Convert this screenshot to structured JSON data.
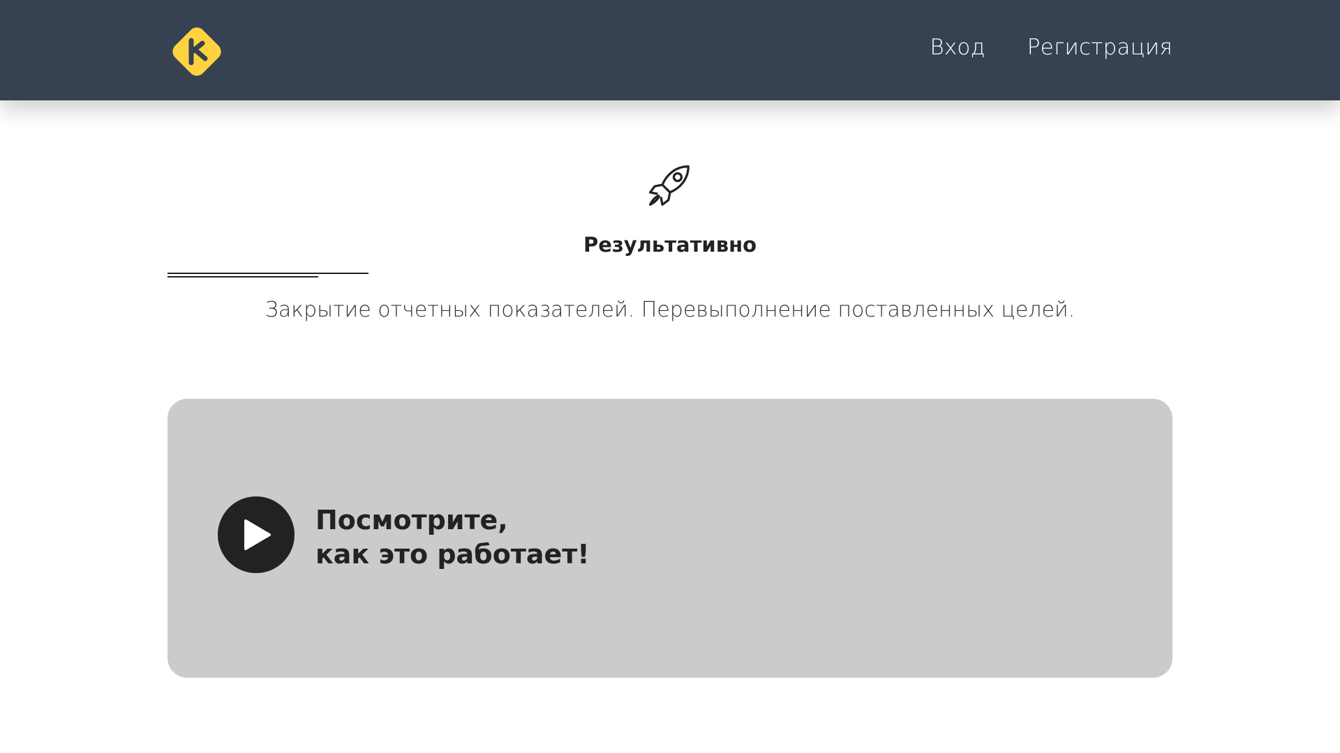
{
  "header": {
    "logo": "k-diamond-logo",
    "nav": {
      "login_label": "Вход",
      "register_label": "Регистрация"
    }
  },
  "feature": {
    "icon": "rocket-icon",
    "title": "Результативно",
    "description": "Закрытие отчетных показателей. Перевыполнение поставленных целей."
  },
  "video": {
    "icon": "play-icon",
    "line1": "Посмотрите,",
    "line2": "как это работает!"
  },
  "colors": {
    "header_bg": "#364152",
    "accent_yellow": "#FFD23F",
    "video_bg": "#CBCBCB",
    "text_dark": "#222222"
  }
}
